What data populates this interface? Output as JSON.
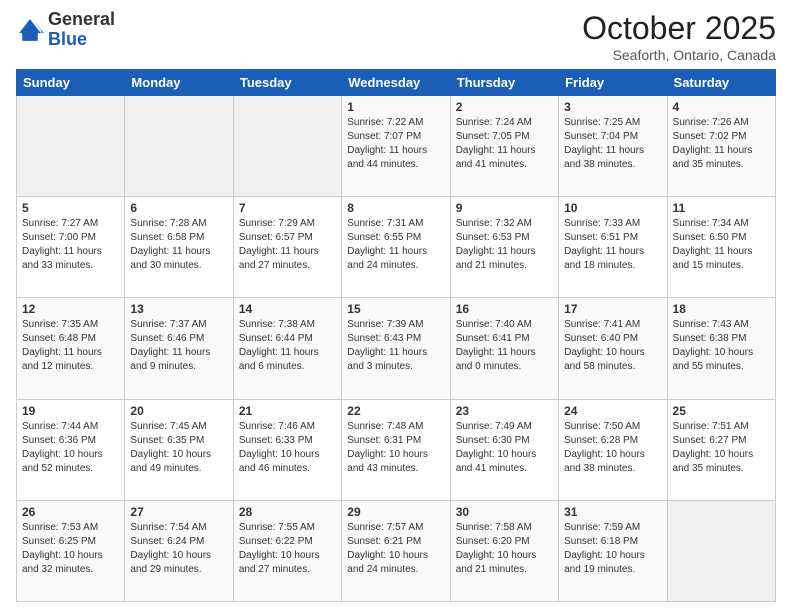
{
  "logo": {
    "general": "General",
    "blue": "Blue"
  },
  "header": {
    "month": "October 2025",
    "location": "Seaforth, Ontario, Canada"
  },
  "weekdays": [
    "Sunday",
    "Monday",
    "Tuesday",
    "Wednesday",
    "Thursday",
    "Friday",
    "Saturday"
  ],
  "weeks": [
    [
      {
        "day": "",
        "info": ""
      },
      {
        "day": "",
        "info": ""
      },
      {
        "day": "",
        "info": ""
      },
      {
        "day": "1",
        "info": "Sunrise: 7:22 AM\nSunset: 7:07 PM\nDaylight: 11 hours and 44 minutes."
      },
      {
        "day": "2",
        "info": "Sunrise: 7:24 AM\nSunset: 7:05 PM\nDaylight: 11 hours and 41 minutes."
      },
      {
        "day": "3",
        "info": "Sunrise: 7:25 AM\nSunset: 7:04 PM\nDaylight: 11 hours and 38 minutes."
      },
      {
        "day": "4",
        "info": "Sunrise: 7:26 AM\nSunset: 7:02 PM\nDaylight: 11 hours and 35 minutes."
      }
    ],
    [
      {
        "day": "5",
        "info": "Sunrise: 7:27 AM\nSunset: 7:00 PM\nDaylight: 11 hours and 33 minutes."
      },
      {
        "day": "6",
        "info": "Sunrise: 7:28 AM\nSunset: 6:58 PM\nDaylight: 11 hours and 30 minutes."
      },
      {
        "day": "7",
        "info": "Sunrise: 7:29 AM\nSunset: 6:57 PM\nDaylight: 11 hours and 27 minutes."
      },
      {
        "day": "8",
        "info": "Sunrise: 7:31 AM\nSunset: 6:55 PM\nDaylight: 11 hours and 24 minutes."
      },
      {
        "day": "9",
        "info": "Sunrise: 7:32 AM\nSunset: 6:53 PM\nDaylight: 11 hours and 21 minutes."
      },
      {
        "day": "10",
        "info": "Sunrise: 7:33 AM\nSunset: 6:51 PM\nDaylight: 11 hours and 18 minutes."
      },
      {
        "day": "11",
        "info": "Sunrise: 7:34 AM\nSunset: 6:50 PM\nDaylight: 11 hours and 15 minutes."
      }
    ],
    [
      {
        "day": "12",
        "info": "Sunrise: 7:35 AM\nSunset: 6:48 PM\nDaylight: 11 hours and 12 minutes."
      },
      {
        "day": "13",
        "info": "Sunrise: 7:37 AM\nSunset: 6:46 PM\nDaylight: 11 hours and 9 minutes."
      },
      {
        "day": "14",
        "info": "Sunrise: 7:38 AM\nSunset: 6:44 PM\nDaylight: 11 hours and 6 minutes."
      },
      {
        "day": "15",
        "info": "Sunrise: 7:39 AM\nSunset: 6:43 PM\nDaylight: 11 hours and 3 minutes."
      },
      {
        "day": "16",
        "info": "Sunrise: 7:40 AM\nSunset: 6:41 PM\nDaylight: 11 hours and 0 minutes."
      },
      {
        "day": "17",
        "info": "Sunrise: 7:41 AM\nSunset: 6:40 PM\nDaylight: 10 hours and 58 minutes."
      },
      {
        "day": "18",
        "info": "Sunrise: 7:43 AM\nSunset: 6:38 PM\nDaylight: 10 hours and 55 minutes."
      }
    ],
    [
      {
        "day": "19",
        "info": "Sunrise: 7:44 AM\nSunset: 6:36 PM\nDaylight: 10 hours and 52 minutes."
      },
      {
        "day": "20",
        "info": "Sunrise: 7:45 AM\nSunset: 6:35 PM\nDaylight: 10 hours and 49 minutes."
      },
      {
        "day": "21",
        "info": "Sunrise: 7:46 AM\nSunset: 6:33 PM\nDaylight: 10 hours and 46 minutes."
      },
      {
        "day": "22",
        "info": "Sunrise: 7:48 AM\nSunset: 6:31 PM\nDaylight: 10 hours and 43 minutes."
      },
      {
        "day": "23",
        "info": "Sunrise: 7:49 AM\nSunset: 6:30 PM\nDaylight: 10 hours and 41 minutes."
      },
      {
        "day": "24",
        "info": "Sunrise: 7:50 AM\nSunset: 6:28 PM\nDaylight: 10 hours and 38 minutes."
      },
      {
        "day": "25",
        "info": "Sunrise: 7:51 AM\nSunset: 6:27 PM\nDaylight: 10 hours and 35 minutes."
      }
    ],
    [
      {
        "day": "26",
        "info": "Sunrise: 7:53 AM\nSunset: 6:25 PM\nDaylight: 10 hours and 32 minutes."
      },
      {
        "day": "27",
        "info": "Sunrise: 7:54 AM\nSunset: 6:24 PM\nDaylight: 10 hours and 29 minutes."
      },
      {
        "day": "28",
        "info": "Sunrise: 7:55 AM\nSunset: 6:22 PM\nDaylight: 10 hours and 27 minutes."
      },
      {
        "day": "29",
        "info": "Sunrise: 7:57 AM\nSunset: 6:21 PM\nDaylight: 10 hours and 24 minutes."
      },
      {
        "day": "30",
        "info": "Sunrise: 7:58 AM\nSunset: 6:20 PM\nDaylight: 10 hours and 21 minutes."
      },
      {
        "day": "31",
        "info": "Sunrise: 7:59 AM\nSunset: 6:18 PM\nDaylight: 10 hours and 19 minutes."
      },
      {
        "day": "",
        "info": ""
      }
    ]
  ]
}
